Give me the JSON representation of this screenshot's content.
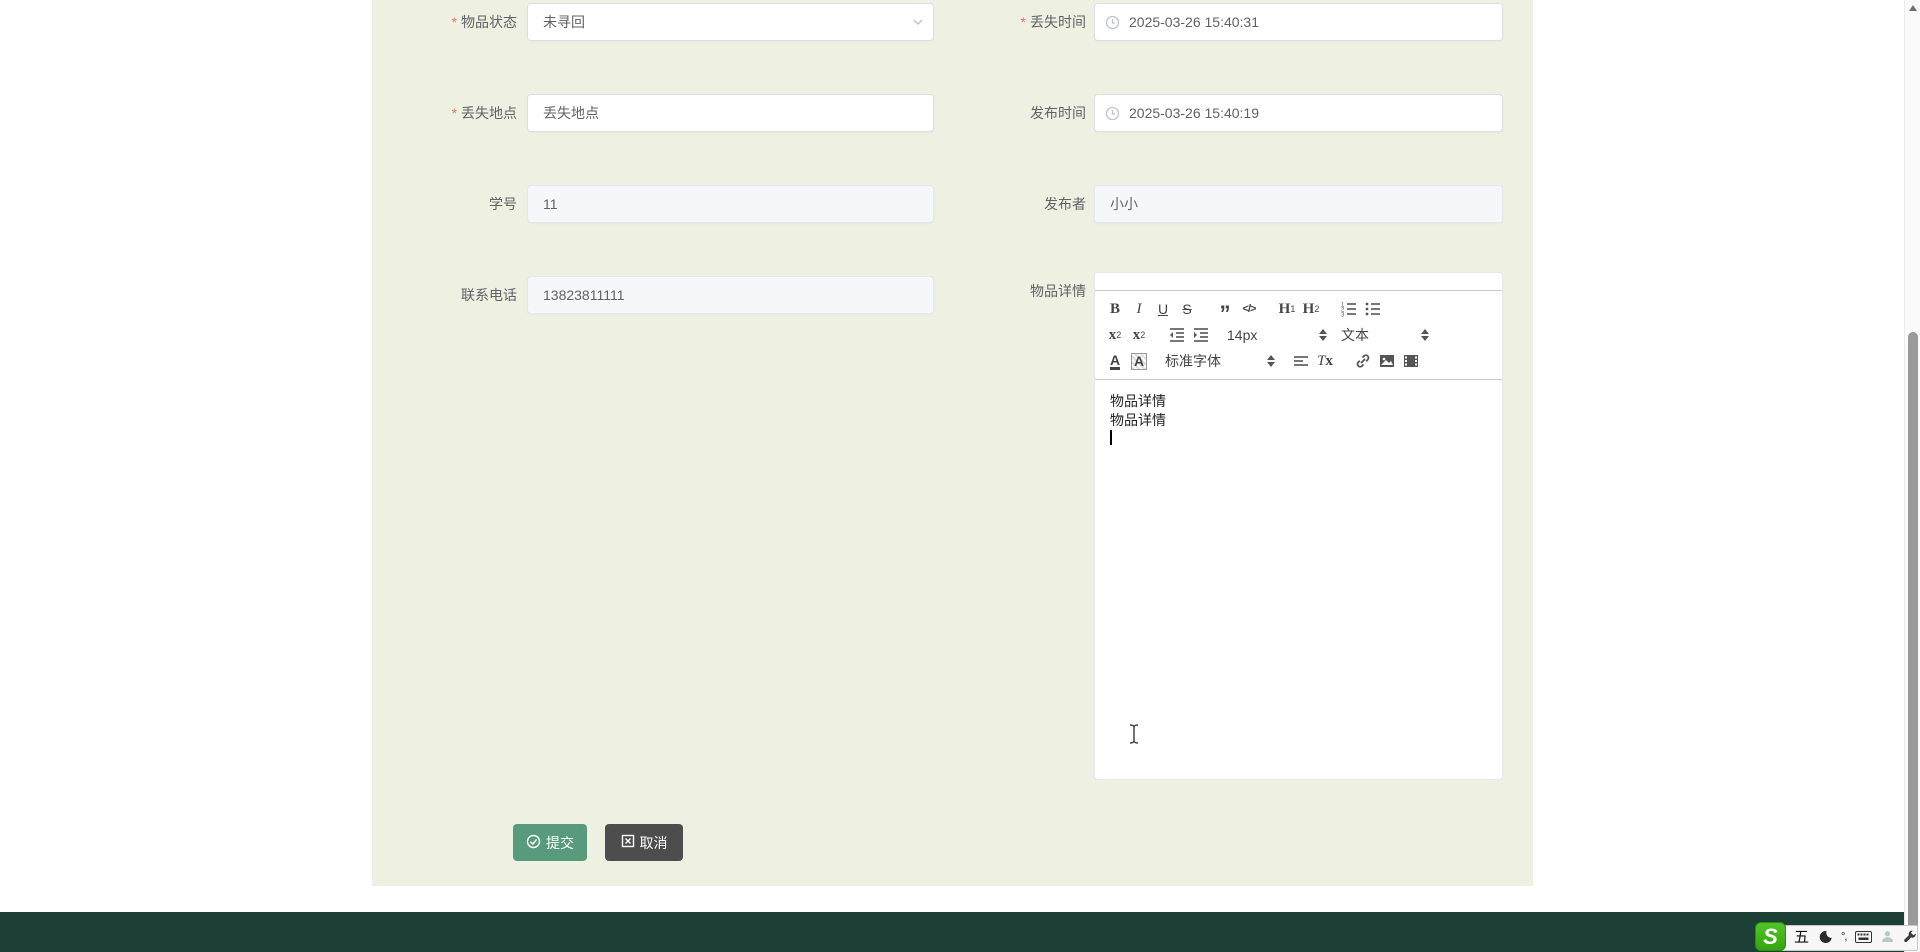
{
  "page": {
    "background": "#ffffff",
    "panel_background": "#eef0e2",
    "footer_background": "#1d4036"
  },
  "colors": {
    "accent_green": "#579b7c",
    "cancel_gray": "#4d4d4d",
    "required_red": "#f56c6c",
    "input_border": "#dcdfe6",
    "disabled_bg": "#f5f7fa",
    "toolbar_border": "#cccccc",
    "scroll_thumb": "#9a9a9a",
    "sogou_green": "#3eb320"
  },
  "form": {
    "required_mark": "*",
    "fields": {
      "status": {
        "label": "物品状态",
        "required": true,
        "value": "未寻回",
        "type": "select"
      },
      "lost_time": {
        "label": "丢失时间",
        "required": true,
        "value": "2025-03-26 15:40:31",
        "type": "datetime"
      },
      "lost_place": {
        "label": "丢失地点",
        "required": true,
        "value": "丢失地点",
        "type": "text"
      },
      "publish_time": {
        "label": "发布时间",
        "required": false,
        "value": "2025-03-26 15:40:19",
        "type": "datetime"
      },
      "student_id": {
        "label": "学号",
        "required": false,
        "value": "11",
        "disabled": true
      },
      "publisher": {
        "label": "发布者",
        "required": false,
        "value": "小小",
        "disabled": true
      },
      "phone": {
        "label": "联系电话",
        "required": false,
        "value": "13823811111",
        "disabled": true
      },
      "detail": {
        "label": "物品详情"
      }
    },
    "buttons": {
      "submit": "提交",
      "cancel": "取消"
    }
  },
  "editor": {
    "lines": {
      "0": "物品详情",
      "1": "物品详情"
    },
    "toolbar": {
      "bold": "B",
      "italic": "I",
      "underline": "U",
      "strike": "S",
      "blockquote": "”",
      "code": "</>",
      "h1": {
        "letter": "H",
        "num": "1"
      },
      "h2": {
        "letter": "H",
        "num": "2"
      },
      "sub": {
        "letter": "x",
        "num": "2"
      },
      "sup": {
        "letter": "x",
        "num": "2"
      },
      "size_value": "14px",
      "header_value": "文本",
      "font_value": "标准字体",
      "color_letter": "A",
      "background_letter": "A",
      "clean": {
        "letter": "T",
        "num": "x"
      }
    }
  },
  "tray": {
    "logo": "S",
    "ime_mode": "五",
    "symbols": "°,"
  }
}
